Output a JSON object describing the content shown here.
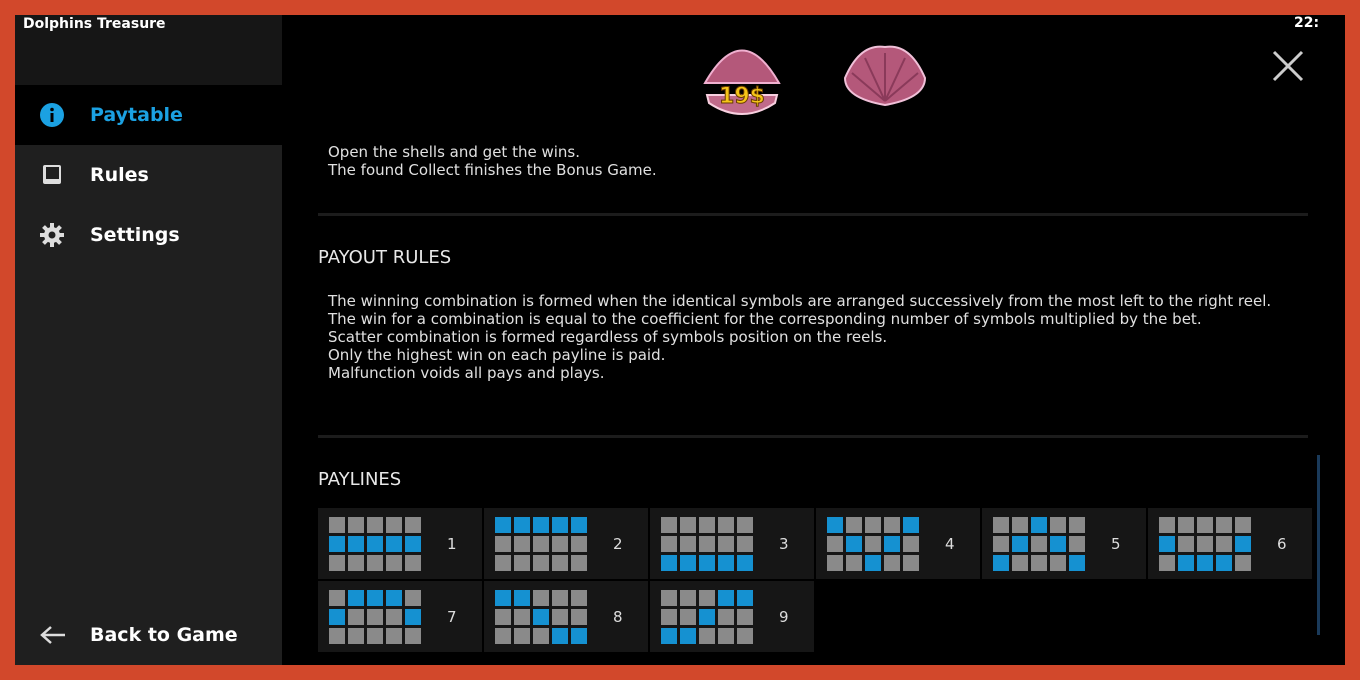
{
  "app_title": "Dolphins Treasure",
  "clock": "22:",
  "sidebar": {
    "items": [
      {
        "label": "Paytable",
        "icon": "info-icon",
        "active": true
      },
      {
        "label": "Rules",
        "icon": "book-icon"
      },
      {
        "label": "Settings",
        "icon": "gear-icon"
      }
    ],
    "back_label": "Back to Game"
  },
  "shells": {
    "value_label": "19$"
  },
  "bonus_text": [
    "Open the shells and get the wins.",
    "The found Collect finishes the Bonus Game."
  ],
  "payout": {
    "title": "PAYOUT RULES",
    "lines": [
      "The winning combination is formed when the identical symbols are arranged successively from the most left to the right reel.",
      "The win for a combination is equal to the coefficient for the corresponding number of symbols multiplied by the bet.",
      "Scatter combination is formed regardless of symbols position on the reels.",
      "Only the highest win on each payline is paid.",
      "Malfunction voids all pays and plays."
    ]
  },
  "paylines": {
    "title": "PAYLINES",
    "items": [
      {
        "number": "1",
        "rows": [
          1,
          1,
          1,
          1,
          1
        ]
      },
      {
        "number": "2",
        "rows": [
          0,
          0,
          0,
          0,
          0
        ]
      },
      {
        "number": "3",
        "rows": [
          2,
          2,
          2,
          2,
          2
        ]
      },
      {
        "number": "4",
        "rows": [
          0,
          1,
          2,
          1,
          0
        ]
      },
      {
        "number": "5",
        "rows": [
          2,
          1,
          0,
          1,
          2
        ]
      },
      {
        "number": "6",
        "rows": [
          1,
          2,
          2,
          2,
          1
        ]
      },
      {
        "number": "7",
        "rows": [
          1,
          0,
          0,
          0,
          1
        ]
      },
      {
        "number": "8",
        "rows": [
          0,
          0,
          1,
          2,
          2
        ]
      },
      {
        "number": "9",
        "rows": [
          2,
          2,
          1,
          0,
          0
        ]
      }
    ]
  },
  "colors": {
    "accent": "#1ba1e2",
    "line_on": "#1591d1",
    "line_off": "#8a8a8a",
    "border": "#d2482b"
  }
}
